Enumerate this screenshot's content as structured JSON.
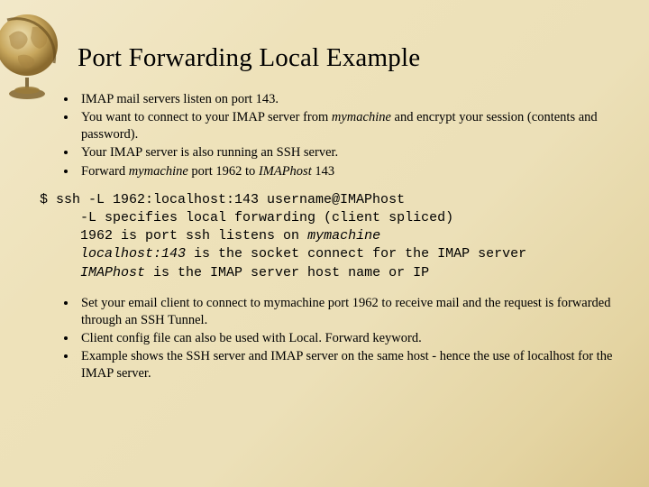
{
  "title": "Port Forwarding Local Example",
  "bullets_top": [
    "IMAP mail servers listen on port 143.",
    "You want to connect to your IMAP server from <span class=\"ital\">mymachine</span> and encrypt your session (contents and password).",
    "Your IMAP server is also running an SSH server.",
    "Forward <span class=\"ital\">mymachine</span> port 1962 to <span class=\"ital\">IMAPhost</span> 143"
  ],
  "code": "$ ssh -L 1962:localhost:143 username@IMAPhost\n     -L specifies local forwarding (client spliced)\n     1962 is port ssh listens on <span class=\"ital\">mymachine</span>\n     <span class=\"ital\">localhost:143</span> is the socket connect for the IMAP server\n     <span class=\"ital\">IMAPhost</span> is the IMAP server host name or IP",
  "bullets_bottom": [
    "Set your email client to connect to mymachine port 1962 to receive mail and the request is forwarded through an SSH Tunnel.",
    "Client config file can also be used with Local. Forward keyword.",
    "Example shows the SSH server and IMAP server on the same host - hence the use of localhost for the IMAP server."
  ]
}
